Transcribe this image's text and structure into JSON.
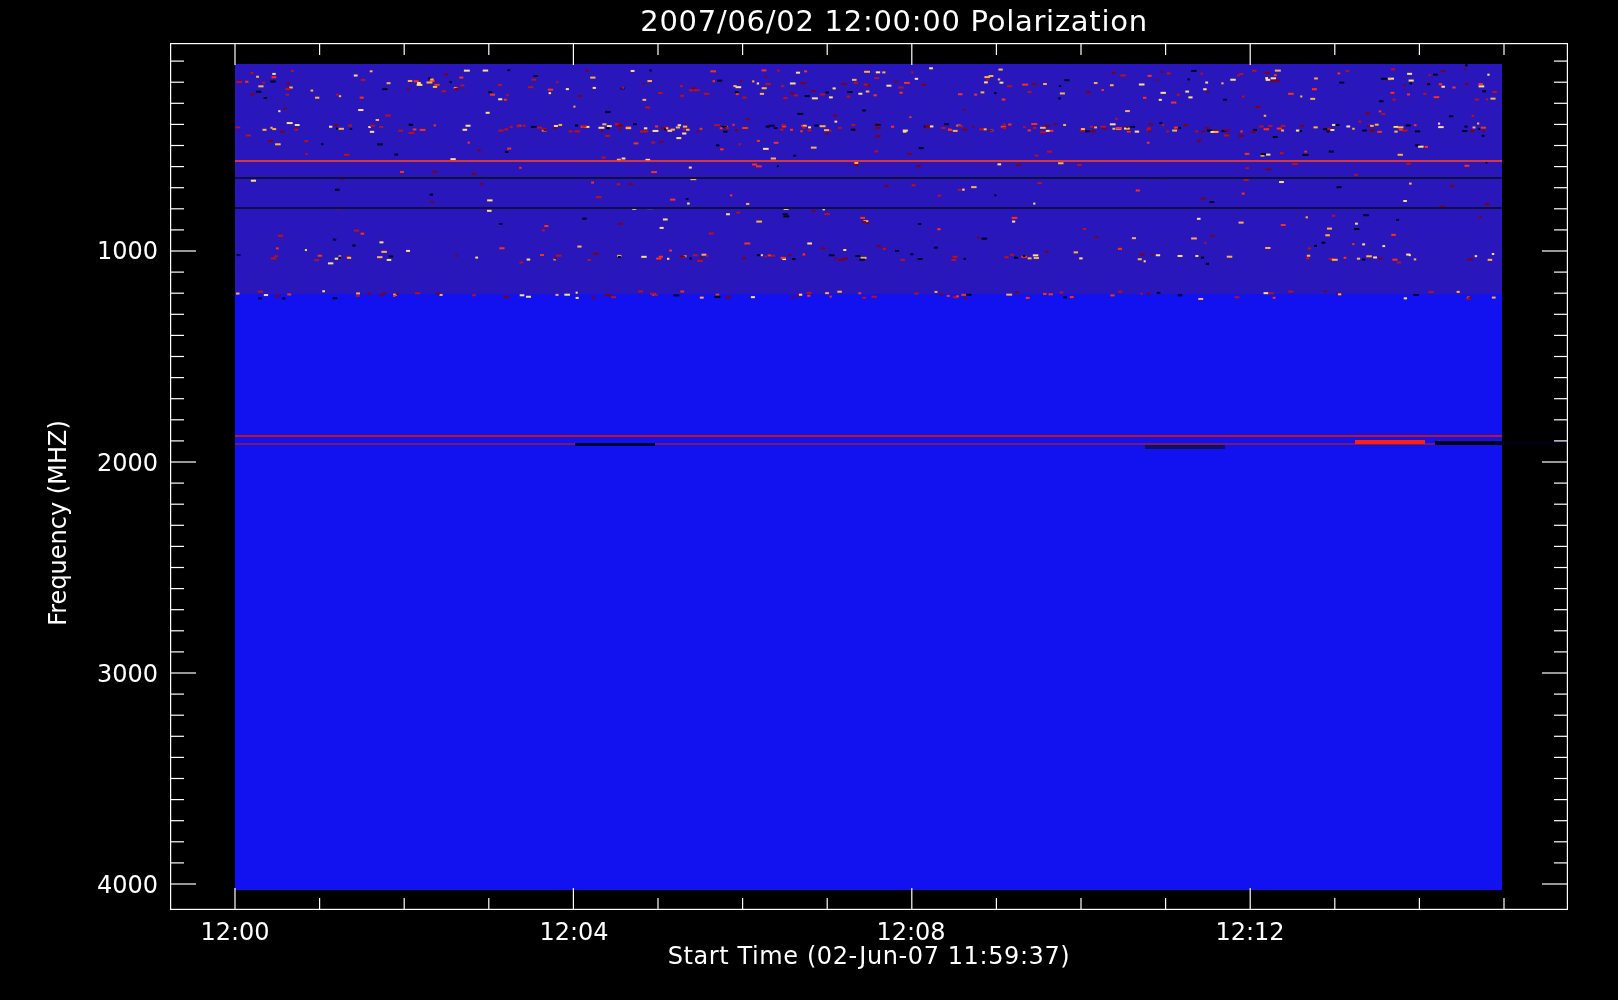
{
  "title": "2007/06/02 12:00:00 Polarization",
  "ylabel": "Frequency (MHZ)",
  "xlabel": "Start Time (02-Jun-07 11:59:37)",
  "yticks": [
    "1000",
    "2000",
    "3000",
    "4000"
  ],
  "xticks": [
    "12:00",
    "12:04",
    "12:08",
    "12:12"
  ]
}
